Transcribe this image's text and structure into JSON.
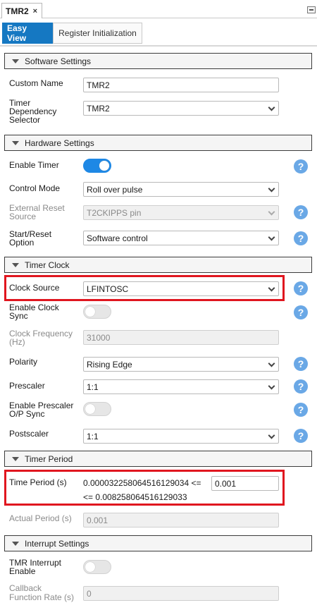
{
  "doc_tab": {
    "title": "TMR2",
    "close": "×"
  },
  "view_tabs": [
    {
      "label": "Easy View"
    },
    {
      "label": "Register Initialization"
    }
  ],
  "sections": {
    "software": "Software Settings",
    "hardware": "Hardware Settings",
    "clock": "Timer Clock",
    "period": "Timer Period",
    "interrupt": "Interrupt Settings"
  },
  "software": {
    "custom_name_label": "Custom Name",
    "custom_name_value": "TMR2",
    "dependency_label_1": "Timer",
    "dependency_label_2": "Dependency",
    "dependency_label_3": "Selector",
    "dependency_value": "TMR2"
  },
  "hardware": {
    "enable_timer_label": "Enable Timer",
    "enable_timer_on": true,
    "control_mode_label": "Control Mode",
    "control_mode_value": "Roll over pulse",
    "ext_reset_label_1": "External Reset",
    "ext_reset_label_2": "Source",
    "ext_reset_value": "T2CKIPPS pin",
    "start_reset_label_1": "Start/Reset",
    "start_reset_label_2": "Option",
    "start_reset_value": "Software control"
  },
  "clock": {
    "clock_source_label": "Clock Source",
    "clock_source_value": "LFINTOSC",
    "clock_sync_label_1": "Enable Clock",
    "clock_sync_label_2": "Sync",
    "clock_freq_label_1": "Clock Frequency",
    "clock_freq_label_2": "(Hz)",
    "clock_freq_value": "31000",
    "polarity_label": "Polarity",
    "polarity_value": "Rising Edge",
    "prescaler_label": "Prescaler",
    "prescaler_value": "1:1",
    "prescaler_sync_label_1": "Enable Prescaler",
    "prescaler_sync_label_2": "O/P Sync",
    "postscaler_label": "Postscaler",
    "postscaler_value": "1:1"
  },
  "period": {
    "time_period_label": "Time Period (s)",
    "min_text": "0.000032258064516129034 <=",
    "value": "0.001",
    "max_text": "<= 0.008258064516129033",
    "actual_label": "Actual Period (s)",
    "actual_value": "0.001"
  },
  "interrupt": {
    "tmr_int_label_1": "TMR Interrupt",
    "tmr_int_label_2": "Enable",
    "callback_label_1": "Callback",
    "callback_label_2": "Function Rate (s)",
    "callback_value": "0"
  },
  "help_glyph": "?",
  "icons": {
    "help": "help-icon",
    "chevron": "chevron-down-icon",
    "collapse": "collapse-triangle-icon"
  },
  "colors": {
    "accent": "#1578c2",
    "toggle_on": "#1e88e5",
    "help": "#6aa8e6",
    "highlight": "#e0161f"
  }
}
